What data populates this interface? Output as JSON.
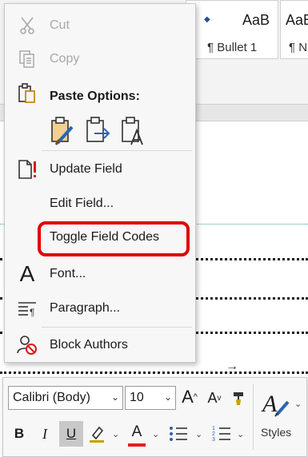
{
  "ribbon": {
    "styles": [
      {
        "sample": "AaB",
        "name": "¶ Bullet 1"
      },
      {
        "sample": "AaB",
        "name": "¶ N"
      }
    ]
  },
  "context_menu": {
    "cut_label": "Cut",
    "copy_label": "Copy",
    "paste_options_label": "Paste Options:",
    "paste_icons": [
      "paste-keep-source-formatting-icon",
      "paste-merge-formatting-icon",
      "paste-keep-text-only-icon"
    ],
    "update_field_label": "Update Field",
    "edit_field_label": "Edit Field...",
    "toggle_field_codes_label": "Toggle Field Codes",
    "font_label": "Font...",
    "paragraph_label": "Paragraph...",
    "block_authors_label": "Block Authors",
    "highlight_color": "#e00000"
  },
  "mini_toolbar": {
    "font_name": "Calibri (Body)",
    "font_size": "10",
    "bold": "B",
    "italic": "I",
    "underline": "U",
    "font_color_letter": "A",
    "styles_label": "Styles",
    "font_color": "#e02020",
    "highlight_color": "#c8a000"
  }
}
